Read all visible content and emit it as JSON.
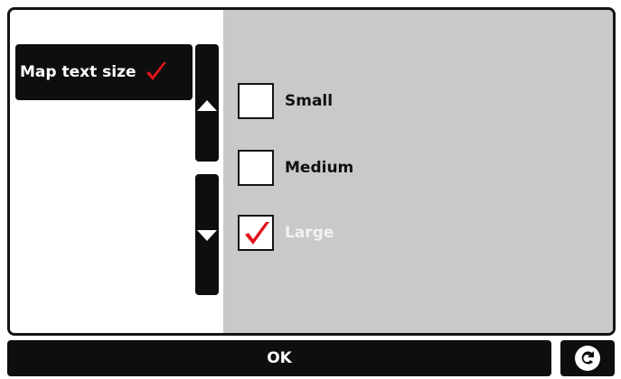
{
  "menu": {
    "selected_label": "Map text size",
    "check_color": "#e0141e"
  },
  "options": [
    {
      "label": "Small",
      "checked": false
    },
    {
      "label": "Medium",
      "checked": false
    },
    {
      "label": "Large",
      "checked": true
    }
  ],
  "footer": {
    "ok_label": "OK",
    "back_icon": "back-arrow-icon"
  },
  "colors": {
    "pane_bg": "#c9c9c9",
    "button_bg": "#0e0e0e",
    "check": "#e0141e"
  }
}
